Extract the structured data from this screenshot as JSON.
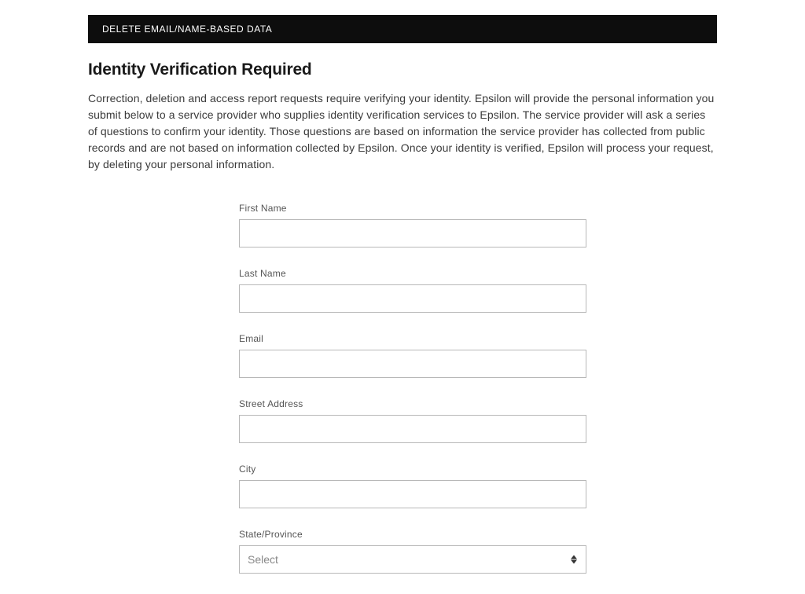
{
  "header": {
    "title": "DELETE EMAIL/NAME-BASED DATA"
  },
  "page": {
    "title": "Identity Verification Required",
    "description": "Correction, deletion and access report requests require verifying your identity. Epsilon will provide the personal information you submit below to a service provider who supplies identity verification services to Epsilon. The service provider will ask a series of questions to confirm your identity. Those questions are based on information the service provider has collected from public records and are not based on information collected by Epsilon. Once your identity is verified, Epsilon will process your request, by deleting your personal information."
  },
  "form": {
    "firstName": {
      "label": "First Name",
      "value": ""
    },
    "lastName": {
      "label": "Last Name",
      "value": ""
    },
    "email": {
      "label": "Email",
      "value": ""
    },
    "streetAddress": {
      "label": "Street Address",
      "value": ""
    },
    "city": {
      "label": "City",
      "value": ""
    },
    "state": {
      "label": "State/Province",
      "selected": "Select"
    }
  }
}
